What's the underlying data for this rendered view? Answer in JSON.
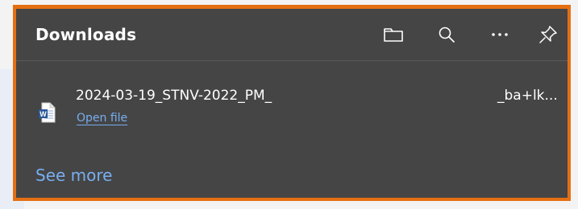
{
  "panel": {
    "title": "Downloads",
    "accent_border": "#e46f12",
    "background": "#454545",
    "link_color": "#78aef0"
  },
  "toolbar": {
    "buttons": [
      {
        "icon": "folder-icon",
        "action": "open-downloads-folder"
      },
      {
        "icon": "search-icon",
        "action": "search-downloads"
      },
      {
        "icon": "more-options-icon",
        "action": "more-options"
      },
      {
        "icon": "pin-icon",
        "action": "pin-to-toolbar"
      }
    ]
  },
  "downloads": [
    {
      "filename_start": "2024-03-19_STNV-2022_PM_",
      "filename_end": "_ba+lk...",
      "icon": "word-document-icon",
      "action_label": "Open file"
    }
  ],
  "footer": {
    "see_more_label": "See more"
  }
}
